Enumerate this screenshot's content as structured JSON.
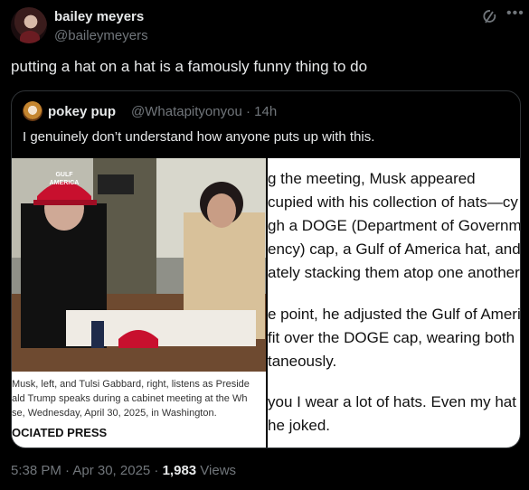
{
  "author": {
    "name": "bailey meyers",
    "handle": "@baileymeyers"
  },
  "post": {
    "text": "putting a hat on a hat is a famously funny thing to do"
  },
  "quoted": {
    "name": "pokey pup",
    "handle": "@Whatapityonyou",
    "time": "· 14h",
    "text": "I genuinely don’t understand how anyone puts up with this.",
    "photo": {
      "hat_text_1": "GULF",
      "hat_text_2": "AMERICA",
      "caption_lines": [
        "Musk, left, and Tulsi Gabbard, right, listens as Preside",
        "ald Trump speaks during a cabinet meeting at the Wh",
        "se, Wednesday, April 30, 2025, in Washington."
      ],
      "credit": "OCIATED PRESS"
    },
    "article_lines": [
      "g the meeting, Musk appeared",
      "cupied with his collection of hats—cy",
      "gh a DOGE (Department of Governme",
      "ency) cap, a Gulf of America hat, and",
      "ately stacking them atop one another",
      "e point, he adjusted the Gulf of Ameri",
      "fit over the DOGE cap, wearing both",
      "taneously.",
      "you I wear a lot of hats. Even my hat",
      "he joked."
    ]
  },
  "footer": {
    "time": "5:38 PM · Apr 30, 2025 · ",
    "views_count": "1,983",
    "views_label": " Views"
  },
  "icons": {
    "grok": "grok-icon",
    "more": "more-icon"
  },
  "colors": {
    "background": "#000000",
    "text": "#e7e9ea",
    "muted": "#71767b",
    "border": "#2f3336",
    "hat_red": "#c8102e"
  }
}
